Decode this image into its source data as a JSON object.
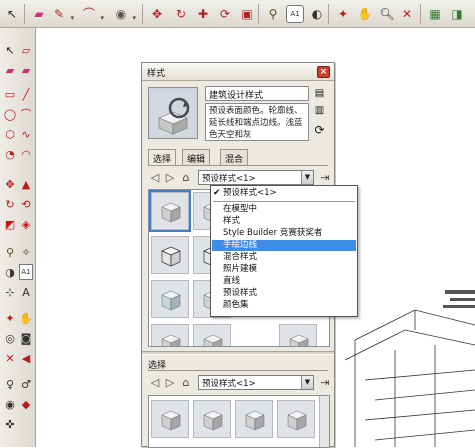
{
  "toolbar_top": {
    "icons": [
      "select-arrow-icon",
      "eraser-icon",
      "pencil-icon",
      "arc-icon",
      "protractor-icon",
      "move-icon",
      "rotate-icon",
      "push-pull-icon",
      "refresh-icon",
      "tape-measure-icon",
      "text-icon",
      "dimension-icon",
      "orbit-icon",
      "pan-icon",
      "zoom-icon",
      "zoom-extents-icon",
      "camera-icon",
      "look-around-icon"
    ],
    "text_tool_label": "A1"
  },
  "toolbar_left": {
    "text_tool_label": "A1"
  },
  "panel": {
    "title": "样式",
    "close_label": "×",
    "style_name": "建筑设计样式",
    "style_description": "预设表面颜色。轮廓线、延长线和端点边线。浅蓝色天空和灰",
    "tabs": [
      "选择",
      "编辑",
      "混合"
    ],
    "selected_collection": "预设样式<1>",
    "lower_section_title": "选择",
    "lower_selected_collection": "预设样式<1>"
  },
  "dropdown": {
    "checked_item": "预设样式<1>",
    "items": [
      "在模型中",
      "样式",
      "Style Builder 竞赛获奖者",
      "手绘边线",
      "混合样式",
      "照片建模",
      "直线",
      "预设样式",
      "颜色集"
    ],
    "highlighted_item": "手绘边线"
  },
  "colors": {
    "accent_highlight": "#3e8ee8",
    "panel_bg": "#ece9e1",
    "close_red": "#c9412d"
  }
}
